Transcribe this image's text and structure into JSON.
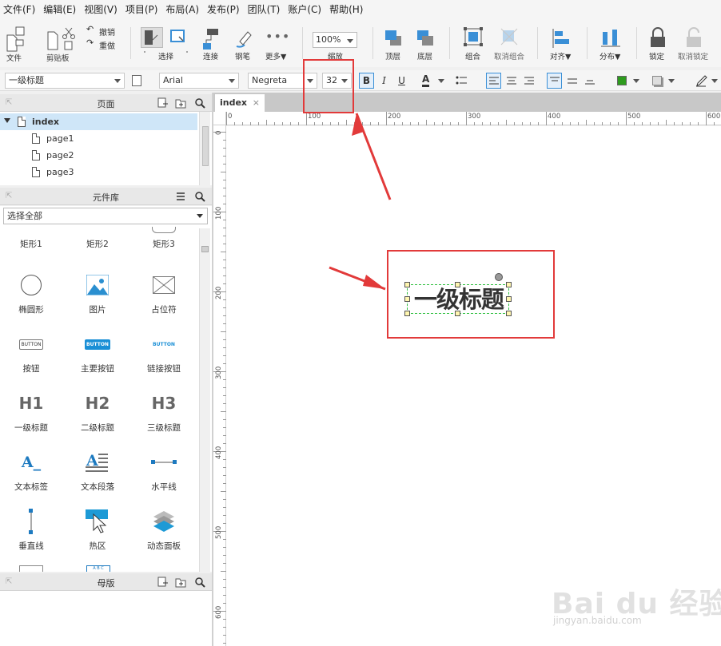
{
  "menu": [
    "文件(F)",
    "编辑(E)",
    "视图(V)",
    "项目(P)",
    "布局(A)",
    "发布(P)",
    "团队(T)",
    "账户(C)",
    "帮助(H)"
  ],
  "toolbar": {
    "file": "文件",
    "clipboard": "剪贴板",
    "undo": "撤销",
    "redo": "重做",
    "select": "选择",
    "connect": "连接",
    "pen": "钢笔",
    "more": "更多▼",
    "zoom_value": "100%",
    "zoom": "缩放",
    "top": "顶层",
    "bottom": "底层",
    "group": "组合",
    "ungroup": "取消组合",
    "align": "对齐▼",
    "distribute": "分布▼",
    "lock": "锁定",
    "unlock": "取消锁定"
  },
  "format": {
    "style": "一级标题",
    "font": "Arial",
    "weight": "Negreta",
    "size": "32",
    "bold": "B",
    "italic": "I",
    "underline": "U",
    "text_color": "A",
    "fill_color": "#2e9b1e"
  },
  "pages_panel": {
    "title": "页面",
    "root": "index",
    "pages": [
      "page1",
      "page2",
      "page3"
    ]
  },
  "library_panel": {
    "title": "元件库",
    "filter": "选择全部",
    "widgets": [
      {
        "label": "矩形1",
        "icon": "rectangle-icon"
      },
      {
        "label": "矩形2",
        "icon": "rectangle-icon"
      },
      {
        "label": "矩形3",
        "icon": "rectangle-icon"
      },
      {
        "label": "椭圆形",
        "icon": "ellipse-icon"
      },
      {
        "label": "图片",
        "icon": "image-icon"
      },
      {
        "label": "占位符",
        "icon": "placeholder-icon"
      },
      {
        "label": "按钮",
        "icon": "button-icon",
        "text": "BUTTON"
      },
      {
        "label": "主要按钮",
        "icon": "primary-button-icon",
        "text": "BUTTON"
      },
      {
        "label": "链接按钮",
        "icon": "link-button-icon",
        "text": "BUTTON"
      },
      {
        "label": "一级标题",
        "icon": "h1-icon",
        "text": "H1"
      },
      {
        "label": "二级标题",
        "icon": "h2-icon",
        "text": "H2"
      },
      {
        "label": "三级标题",
        "icon": "h3-icon",
        "text": "H3"
      },
      {
        "label": "文本标签",
        "icon": "text-label-icon",
        "text": "A_"
      },
      {
        "label": "文本段落",
        "icon": "text-paragraph-icon",
        "text": "A"
      },
      {
        "label": "水平线",
        "icon": "horizontal-line-icon"
      },
      {
        "label": "垂直线",
        "icon": "vertical-line-icon"
      },
      {
        "label": "热区",
        "icon": "hotspot-icon"
      },
      {
        "label": "动态面板",
        "icon": "dynamic-panel-icon"
      }
    ],
    "partial_icon_text": "A B C"
  },
  "master_panel": {
    "title": "母版"
  },
  "canvas": {
    "tab": "index",
    "tab_close": "×",
    "h_ruler": [
      "0",
      "100",
      "200",
      "300",
      "400",
      "500",
      "600"
    ],
    "v_ruler": [
      "0",
      "100",
      "200",
      "300",
      "400",
      "500",
      "600"
    ],
    "heading_text": "一级标题"
  },
  "watermark": {
    "logo": "Bai du 经验",
    "url": "jingyan.baidu.com"
  },
  "colors": {
    "accent": "#3a8fd6",
    "callout": "#e23a3a",
    "selection": "#2fbf3f"
  }
}
